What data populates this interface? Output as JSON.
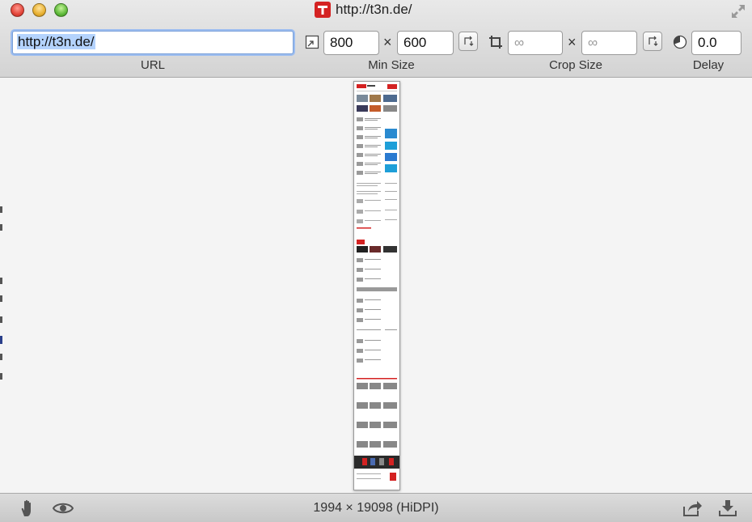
{
  "window": {
    "title": "http://t3n.de/"
  },
  "url": {
    "value": "http://t3n.de/",
    "label": "URL"
  },
  "min_size": {
    "width": "800",
    "height": "600",
    "separator": "×",
    "label": "Min Size"
  },
  "crop_size": {
    "width_placeholder": "∞",
    "height_placeholder": "∞",
    "separator": "×",
    "label": "Crop Size"
  },
  "delay": {
    "value": "0.0",
    "label": "Delay"
  },
  "status": {
    "dimensions": "1994 × 19098 (HiDPI)"
  },
  "icons": {
    "app": "t3n-logo-icon",
    "fullscreen": "fullscreen-icon",
    "min_size": "resize-icon",
    "swap_min": "swap-icon",
    "crop": "crop-icon",
    "swap_crop": "swap-icon",
    "delay": "timer-icon",
    "hand": "hand-icon",
    "eye": "eye-icon",
    "share": "share-icon",
    "download": "download-icon"
  },
  "colors": {
    "brand": "#d42222",
    "selection": "#b4d3fd",
    "focus_ring": "#9cbdf0"
  }
}
